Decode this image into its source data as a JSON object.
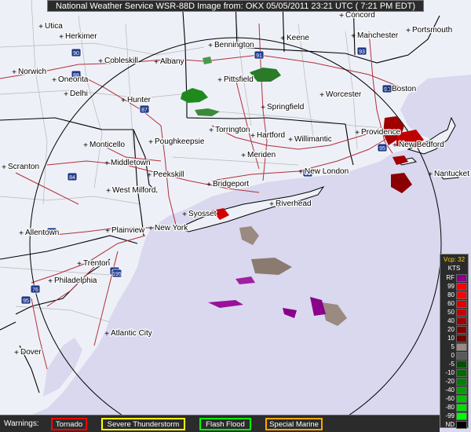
{
  "header": {
    "title": "National Weather Service WSR-88D Image from: OKX 05/05/2011 23:21 UTC ( 7:21 PM EDT)"
  },
  "map": {
    "cities": [
      {
        "name": "Utica"
      },
      {
        "name": "Herkimer"
      },
      {
        "name": "Norwich"
      },
      {
        "name": "Oneonta"
      },
      {
        "name": "Delhi"
      },
      {
        "name": "Cobleskill"
      },
      {
        "name": "Albany"
      },
      {
        "name": "Hunter"
      },
      {
        "name": "Bennington"
      },
      {
        "name": "Keene"
      },
      {
        "name": "Concord"
      },
      {
        "name": "Manchester"
      },
      {
        "name": "Portsmouth"
      },
      {
        "name": "Pittsfield"
      },
      {
        "name": "Worcester"
      },
      {
        "name": "Boston"
      },
      {
        "name": "Springfield"
      },
      {
        "name": "Torrington"
      },
      {
        "name": "Hartford"
      },
      {
        "name": "Willimantic"
      },
      {
        "name": "Providence"
      },
      {
        "name": "New Bedford"
      },
      {
        "name": "Nantucket"
      },
      {
        "name": "Monticello"
      },
      {
        "name": "Poughkeepsie"
      },
      {
        "name": "Middletown"
      },
      {
        "name": "Scranton"
      },
      {
        "name": "Meriden"
      },
      {
        "name": "New London"
      },
      {
        "name": "Peekskill"
      },
      {
        "name": "West Milford"
      },
      {
        "name": "Bridgeport"
      },
      {
        "name": "Riverhead"
      },
      {
        "name": "Syosset"
      },
      {
        "name": "Allentown"
      },
      {
        "name": "Plainview"
      },
      {
        "name": "New York"
      },
      {
        "name": "Trenton"
      },
      {
        "name": "Philadelphia"
      },
      {
        "name": "Atlantic City"
      },
      {
        "name": "Dover"
      }
    ],
    "highways": [
      {
        "id": "90"
      },
      {
        "id": "88"
      },
      {
        "id": "87"
      },
      {
        "id": "91"
      },
      {
        "id": "93"
      },
      {
        "id": "90"
      },
      {
        "id": "84"
      },
      {
        "id": "95"
      },
      {
        "id": "95"
      },
      {
        "id": "78"
      },
      {
        "id": "95"
      },
      {
        "id": "76"
      },
      {
        "id": "95"
      },
      {
        "id": "195"
      }
    ]
  },
  "legend": {
    "title": "Vcp: 32",
    "units": "KTS",
    "items": [
      {
        "label": "RF",
        "color": "#8a008a"
      },
      {
        "label": "99",
        "color": "#ff0000"
      },
      {
        "label": "80",
        "color": "#ff0000"
      },
      {
        "label": "60",
        "color": "#e00000"
      },
      {
        "label": "50",
        "color": "#c80000"
      },
      {
        "label": "40",
        "color": "#a00000"
      },
      {
        "label": "20",
        "color": "#800000"
      },
      {
        "label": "10",
        "color": "#6e0000"
      },
      {
        "label": "5",
        "color": "#9a8a80"
      },
      {
        "label": "0",
        "color": "#5a5a5a"
      },
      {
        "label": "-5",
        "color": "#005000"
      },
      {
        "label": "-10",
        "color": "#006a00"
      },
      {
        "label": "-20",
        "color": "#008000"
      },
      {
        "label": "-40",
        "color": "#00a000"
      },
      {
        "label": "-60",
        "color": "#00c000"
      },
      {
        "label": "-80",
        "color": "#00e000"
      },
      {
        "label": "-99",
        "color": "#00ff00"
      },
      {
        "label": "ND",
        "color": "#000000"
      }
    ]
  },
  "warnings": {
    "label": "Warnings:",
    "items": [
      {
        "label": "Tornado",
        "color": "#ff0000"
      },
      {
        "label": "Severe Thunderstorm",
        "color": "#ffff00"
      },
      {
        "label": "Flash Flood",
        "color": "#00ff00"
      },
      {
        "label": "Special Marine",
        "color": "#ffa500"
      }
    ]
  },
  "colors": {
    "land": "#eef0f7",
    "water": "#d9d8ef",
    "state_border": "#000000",
    "county_border": "#b7b7b7",
    "roads": "#b0303a",
    "range_ring": "#000000"
  }
}
